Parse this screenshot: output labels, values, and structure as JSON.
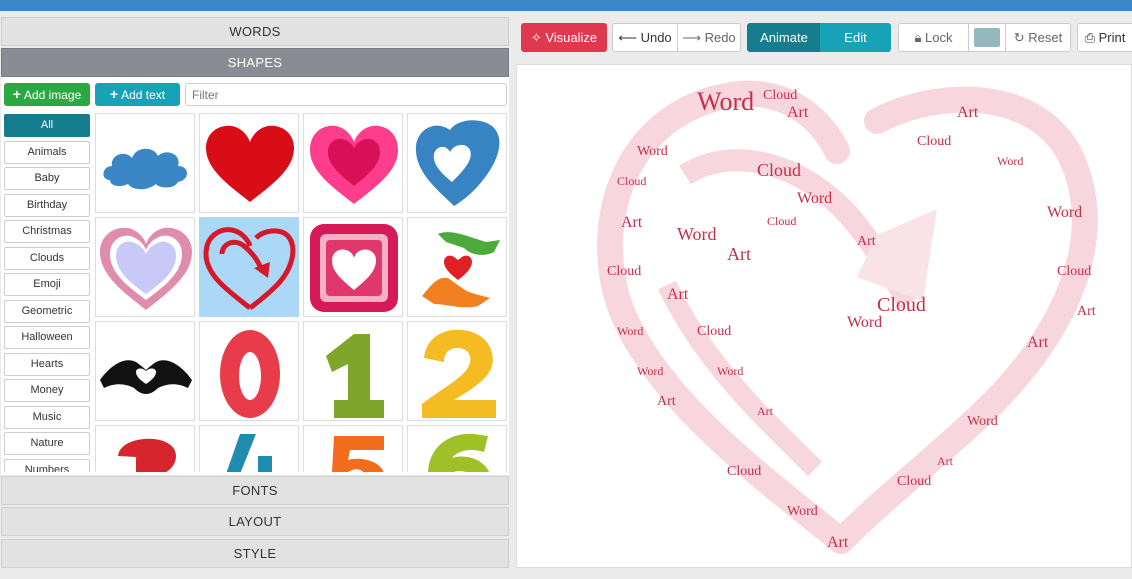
{
  "sidebar": {
    "sections": {
      "words": "WORDS",
      "shapes": "SHAPES",
      "fonts": "FONTS",
      "layout": "LAYOUT",
      "style": "STYLE"
    },
    "add_image": "Add image",
    "add_text": "Add text",
    "filter_placeholder": "Filter",
    "categories": [
      "All",
      "Animals",
      "Baby",
      "Birthday",
      "Christmas",
      "Clouds",
      "Emoji",
      "Geometric",
      "Halloween",
      "Hearts",
      "Money",
      "Music",
      "Nature",
      "Numbers"
    ],
    "selected_category": "All",
    "shapes": [
      "cloud",
      "heart-red",
      "heart-pink-double",
      "heart-blue-outline",
      "heart-lavender",
      "heart-arrow",
      "heart-square",
      "hands-heart",
      "hands-heart-silhouette",
      "number-0",
      "number-1",
      "number-2",
      "number-3",
      "number-4",
      "number-5",
      "number-6"
    ],
    "selected_shape": "heart-arrow"
  },
  "toolbar": {
    "visualize": "Visualize",
    "undo": "Undo",
    "redo": "Redo",
    "animate": "Animate",
    "edit": "Edit",
    "lock": "Lock",
    "reset": "Reset",
    "print": "Print",
    "color_swatch": "#93b9bf"
  },
  "cloud_words": [
    "Word",
    "Art",
    "Cloud"
  ],
  "colors": {
    "accent_red": "#e0384f",
    "teal_dark": "#167d8f",
    "teal": "#17a2b8",
    "green": "#29a844",
    "word_red": "#c42f4a",
    "topbar": "#3b87c9"
  }
}
